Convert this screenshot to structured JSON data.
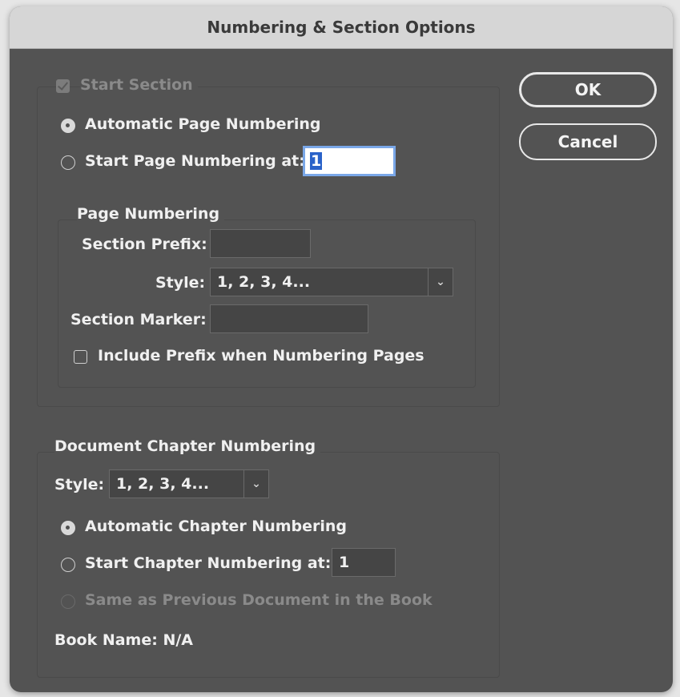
{
  "dialog": {
    "title": "Numbering & Section Options"
  },
  "buttons": {
    "ok": "OK",
    "cancel": "Cancel"
  },
  "start_section": {
    "label": "Start Section",
    "checked": true,
    "enabled": false
  },
  "page_numbering_mode": {
    "automatic_label": "Automatic Page Numbering",
    "start_at_label": "Start Page Numbering at:",
    "start_at_value": "1",
    "selected": "automatic"
  },
  "page_numbering": {
    "group_label": "Page Numbering",
    "section_prefix_label": "Section Prefix:",
    "section_prefix_value": "",
    "style_label": "Style:",
    "style_value": "1, 2, 3, 4...",
    "section_marker_label": "Section Marker:",
    "section_marker_value": "",
    "include_prefix_label": "Include Prefix when Numbering Pages",
    "include_prefix_checked": false
  },
  "chapter_numbering": {
    "group_label": "Document Chapter Numbering",
    "style_label": "Style:",
    "style_value": "1, 2, 3, 4...",
    "automatic_label": "Automatic Chapter Numbering",
    "start_at_label": "Start Chapter Numbering at:",
    "start_at_value": "1",
    "same_as_previous_label": "Same as Previous Document in the Book",
    "selected": "automatic",
    "book_name_label": "Book Name: N/A"
  },
  "icons": {
    "dropdown": "chevron-down-icon",
    "checkmark": "checkmark-icon"
  },
  "colors": {
    "dialog_bg": "#535353",
    "titlebar_bg": "#d6d6d6",
    "focus_ring": "#7aa7e8",
    "selection": "#2a62c9"
  }
}
